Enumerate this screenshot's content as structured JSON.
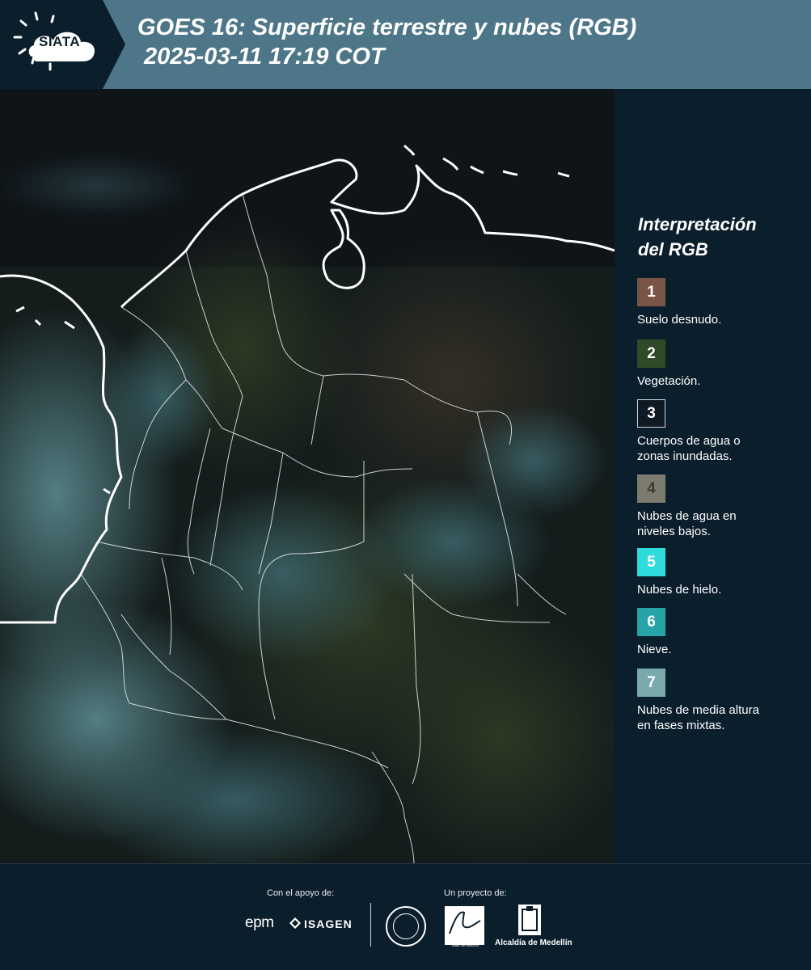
{
  "header": {
    "logo_text": "SIATA",
    "title_line1": "GOES 16: Superficie terrestre y nubes (RGB)",
    "title_line2": "2025-03-11 17:19 COT"
  },
  "legend": {
    "title_line1": "Interpretación",
    "title_line2": "del RGB",
    "items": [
      {
        "number": "1",
        "color": "#7a5446",
        "label_line1": "Suelo desnudo.",
        "label_line2": ""
      },
      {
        "number": "2",
        "color": "#2f4a26",
        "label_line1": "Vegetación.",
        "label_line2": ""
      },
      {
        "number": "3",
        "color": "#101a24",
        "label_line1": "Cuerpos de agua o",
        "label_line2": "zonas inundadas."
      },
      {
        "number": "4",
        "color": "#7d7a70",
        "label_line1": "Nubes de agua en",
        "label_line2": "niveles bajos."
      },
      {
        "number": "5",
        "color": "#2fdcdc",
        "label_line1": "Nubes de hielo.",
        "label_line2": ""
      },
      {
        "number": "6",
        "color": "#26a4a8",
        "label_line1": "Nieve.",
        "label_line2": ""
      },
      {
        "number": "7",
        "color": "#7aa9ab",
        "label_line1": "Nubes de media altura",
        "label_line2": "en fases mixtas."
      }
    ]
  },
  "footer": {
    "support_label": "Con el apoyo de:",
    "project_label": "Un proyecto de:",
    "epm_text": "epm",
    "isagen_text": "ISAGEN",
    "area_caption": "METROPOLITANA Valle de Aburrá",
    "alcaldia_text": "Alcaldía de Medellín"
  }
}
